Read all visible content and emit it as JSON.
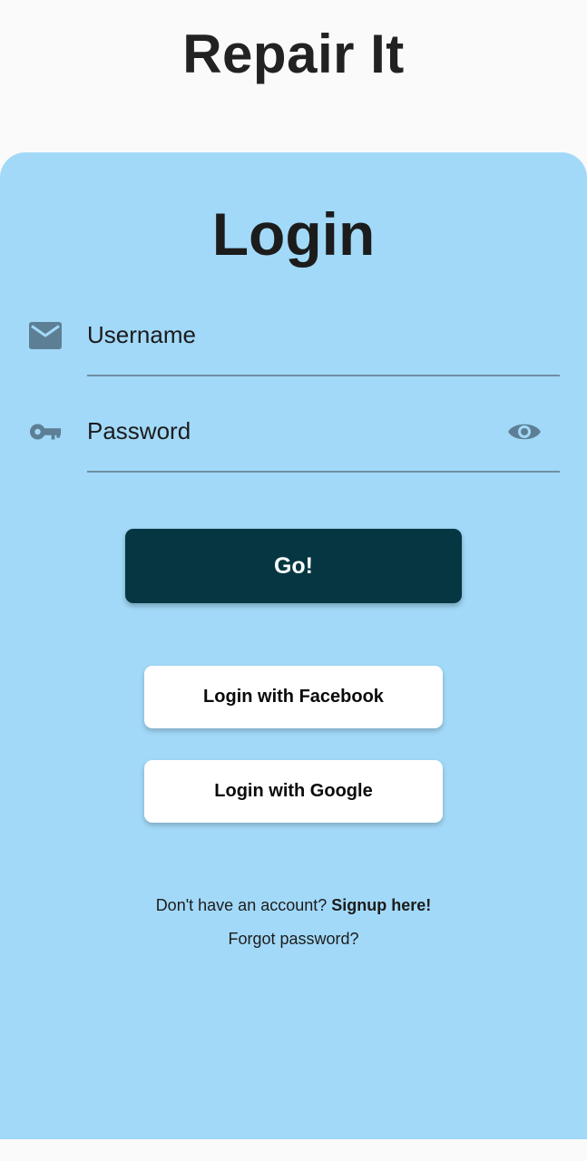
{
  "app": {
    "title": "Repair It"
  },
  "login": {
    "heading": "Login",
    "username": {
      "placeholder": "Username",
      "value": "",
      "icon": "mail-icon"
    },
    "password": {
      "placeholder": "Password",
      "value": "",
      "icon": "key-icon",
      "toggle_icon": "eye-icon"
    },
    "submit_label": "Go!"
  },
  "social": {
    "facebook_label": "Login with Facebook",
    "google_label": "Login with Google"
  },
  "footer": {
    "signup_prompt": "Don't have an account?",
    "signup_link": "Signup here!",
    "forgot_password": "Forgot password?"
  },
  "colors": {
    "background": "#fafafa",
    "card": "#a2d9f8",
    "primary_button": "#053642",
    "icon": "#5d7f95",
    "text": "#1c1c1c"
  }
}
